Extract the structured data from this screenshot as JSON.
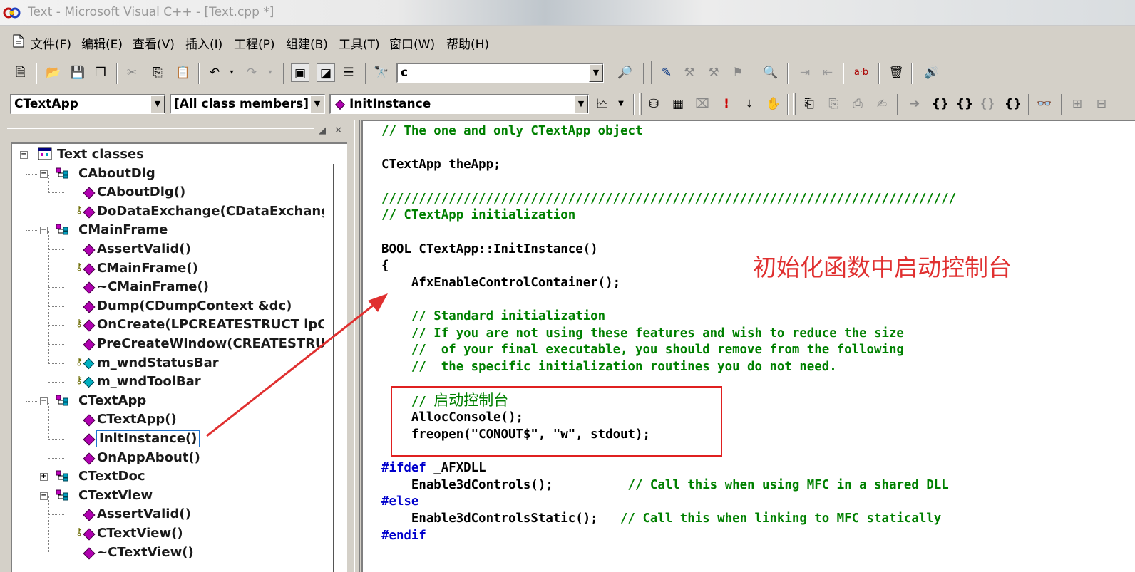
{
  "window": {
    "title": "Text - Microsoft Visual C++ - [Text.cpp *]"
  },
  "menu": {
    "items": [
      "文件(F)",
      "编辑(E)",
      "查看(V)",
      "插入(I)",
      "工程(P)",
      "组建(B)",
      "工具(T)",
      "窗口(W)",
      "帮助(H)"
    ]
  },
  "toolbar": {
    "find_combo_value": "c",
    "class_combo": "CTextApp",
    "filter_combo": "[All class members]",
    "member_combo": "InitInstance",
    "text_btn_label": "a·b"
  },
  "tree": {
    "root": "Text classes",
    "nodes": [
      {
        "label": "CAboutDlg",
        "kind": "class",
        "expander": "⊟"
      },
      {
        "label": "CAboutDlg()",
        "kind": "method"
      },
      {
        "label": "DoDataExchange(CDataExchange",
        "kind": "protected-method"
      },
      {
        "label": "CMainFrame",
        "kind": "class",
        "expander": "⊟"
      },
      {
        "label": "AssertValid()",
        "kind": "method"
      },
      {
        "label": "CMainFrame()",
        "kind": "protected-method"
      },
      {
        "label": "~CMainFrame()",
        "kind": "method"
      },
      {
        "label": "Dump(CDumpContext &dc)",
        "kind": "method"
      },
      {
        "label": "OnCreate(LPCREATESTRUCT lpC",
        "kind": "protected-method"
      },
      {
        "label": "PreCreateWindow(CREATESTRU(",
        "kind": "method"
      },
      {
        "label": "m_wndStatusBar",
        "kind": "protected-var"
      },
      {
        "label": "m_wndToolBar",
        "kind": "protected-var"
      },
      {
        "label": "CTextApp",
        "kind": "class",
        "expander": "⊟"
      },
      {
        "label": "CTextApp()",
        "kind": "method"
      },
      {
        "label": "InitInstance()",
        "kind": "method",
        "selected": true
      },
      {
        "label": "OnAppAbout()",
        "kind": "method"
      },
      {
        "label": "CTextDoc",
        "kind": "class",
        "expander": "⊞"
      },
      {
        "label": "CTextView",
        "kind": "class",
        "expander": "⊟"
      },
      {
        "label": "AssertValid()",
        "kind": "method"
      },
      {
        "label": "CTextView()",
        "kind": "protected-method"
      },
      {
        "label": "~CTextView()",
        "kind": "method"
      }
    ]
  },
  "code": {
    "lines": [
      {
        "parts": [
          {
            "t": "// The one and only CTextApp object",
            "c": "comment"
          }
        ]
      },
      {
        "parts": []
      },
      {
        "parts": [
          {
            "t": "CTextApp theApp;",
            "c": "normal"
          }
        ]
      },
      {
        "parts": []
      },
      {
        "parts": [
          {
            "t": "/////////////////////////////////////////////////////////////////////////////",
            "c": "comment"
          }
        ]
      },
      {
        "parts": [
          {
            "t": "// CTextApp initialization",
            "c": "comment"
          }
        ]
      },
      {
        "parts": []
      },
      {
        "parts": [
          {
            "t": "BOOL CTextApp::InitInstance()",
            "c": "normal"
          }
        ]
      },
      {
        "parts": [
          {
            "t": "{",
            "c": "normal"
          }
        ]
      },
      {
        "parts": [
          {
            "t": "    AfxEnableControlContainer();",
            "c": "normal"
          }
        ]
      },
      {
        "parts": []
      },
      {
        "parts": [
          {
            "t": "    // Standard initialization",
            "c": "comment"
          }
        ]
      },
      {
        "parts": [
          {
            "t": "    // If you are not using these features and wish to reduce the size",
            "c": "comment"
          }
        ]
      },
      {
        "parts": [
          {
            "t": "    //  of your final executable, you should remove from the following",
            "c": "comment"
          }
        ]
      },
      {
        "parts": [
          {
            "t": "    //  the specific initialization routines you do not need.",
            "c": "comment"
          }
        ]
      },
      {
        "parts": []
      },
      {
        "parts": [
          {
            "t": "    // ",
            "c": "comment"
          },
          {
            "t": "启动控制台",
            "c": "cjk"
          }
        ]
      },
      {
        "parts": [
          {
            "t": "    AllocConsole();",
            "c": "normal"
          }
        ]
      },
      {
        "parts": [
          {
            "t": "    freopen(\"CONOUT$\", \"w\", stdout);",
            "c": "normal"
          }
        ]
      },
      {
        "parts": []
      },
      {
        "parts": [
          {
            "t": "#ifdef",
            "c": "kw"
          },
          {
            "t": " _AFXDLL",
            "c": "normal"
          }
        ]
      },
      {
        "parts": [
          {
            "t": "    Enable3dControls();          ",
            "c": "normal"
          },
          {
            "t": "// Call this when using MFC in a shared DLL",
            "c": "comment"
          }
        ]
      },
      {
        "parts": [
          {
            "t": "#else",
            "c": "kw"
          }
        ]
      },
      {
        "parts": [
          {
            "t": "    Enable3dControlsStatic();   ",
            "c": "normal"
          },
          {
            "t": "// Call this when linking to MFC statically",
            "c": "comment"
          }
        ]
      },
      {
        "parts": [
          {
            "t": "#endif",
            "c": "kw"
          }
        ]
      }
    ]
  },
  "annotation": {
    "text": "初始化函数中启动控制台",
    "color": "#e03030"
  }
}
